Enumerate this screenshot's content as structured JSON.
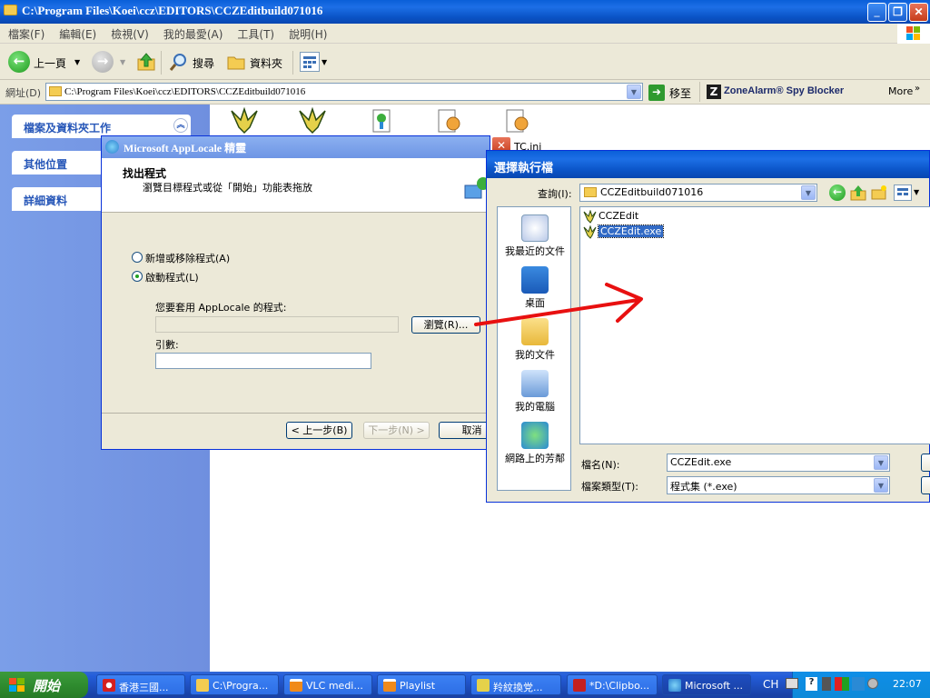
{
  "window": {
    "title": "C:\\Program Files\\Koei\\ccz\\EDITORS\\CCZEditbuild071016",
    "min": "_",
    "max": "❐",
    "close": "✕"
  },
  "menu": [
    "檔案(F)",
    "編輯(E)",
    "檢視(V)",
    "我的最愛(A)",
    "工具(T)",
    "說明(H)"
  ],
  "toolbar": {
    "back": "上一頁",
    "search": "搜尋",
    "folders": "資料夾"
  },
  "address": {
    "label": "網址(D)",
    "value": "C:\\Program Files\\Koei\\ccz\\EDITORS\\CCZEditbuild071016",
    "go": "移至",
    "zonealarm": "ZoneAlarm® Spy Blocker",
    "more": "More"
  },
  "leftpane": {
    "items": [
      "檔案及資料夾工作",
      "其他位置",
      "詳細資料"
    ]
  },
  "files": {
    "partial_label": "TC.ini"
  },
  "applocale": {
    "title": "Microsoft AppLocale 精靈",
    "header_title": "找出程式",
    "header_sub": "瀏覽目標程式或從「開始」功能表拖放",
    "opt_add": "新增或移除程式(A)",
    "opt_launch": "啟動程式(L)",
    "program_label": "您要套用 AppLocale 的程式:",
    "browse": "瀏覽(R)...",
    "args_label": "引數:",
    "back": "< 上一步(B)",
    "next": "下一步(N) >",
    "cancel": "取消"
  },
  "opendlg": {
    "title": "選擇執行檔",
    "lookin_label": "查詢(I):",
    "lookin_value": "CCZEditbuild071016",
    "places": [
      "我最近的文件",
      "桌面",
      "我的文件",
      "我的電腦",
      "網路上的芳鄰"
    ],
    "files": [
      "CCZEdit",
      "CCZEdit.exe"
    ],
    "filename_label": "檔名(N):",
    "filename_value": "CCZEdit.exe",
    "filetype_label": "檔案類型(T):",
    "filetype_value": "程式集 (*.exe)"
  },
  "taskbar": {
    "start": "開始",
    "tasks": [
      "香港三國...",
      "C:\\Progra...",
      "VLC medi...",
      "Playlist",
      "羚紋換党...",
      "*D:\\Clipbo...",
      "Microsoft ..."
    ],
    "lang": "CH",
    "time": "22:07"
  },
  "colors": {
    "xp_blue": "#0a5fd8",
    "arrow_red": "#e81010",
    "start_green": "#2f8c2f"
  }
}
